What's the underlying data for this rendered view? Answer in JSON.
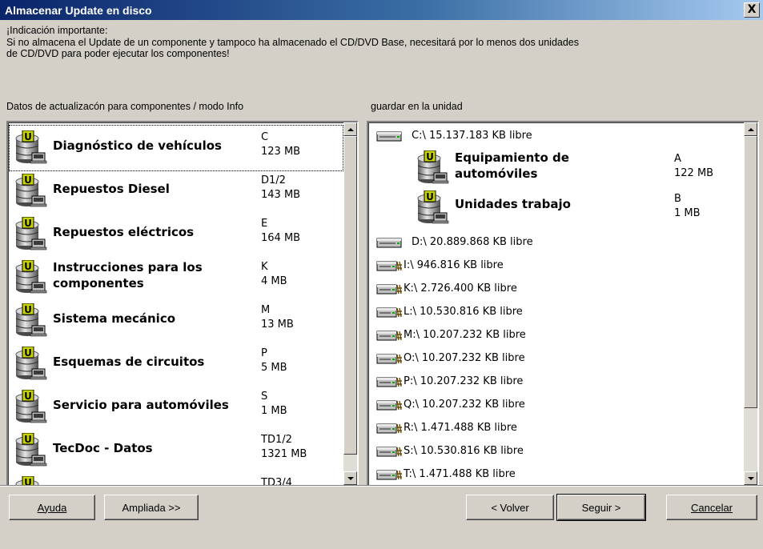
{
  "window": {
    "title": "Almacenar Update en disco",
    "close_glyph": "X"
  },
  "notice": {
    "line1": "¡Indicación importante:",
    "line2": "Si no almacena el Update de un componente y tampoco ha almacenado el CD/DVD Base, necesitará por lo menos dos unidades",
    "line3": "de CD/DVD para poder ejecutar los componentes!"
  },
  "left_label": "Datos de actualizacón para componentes / modo Info",
  "right_label": "guardar en la unidad",
  "components": [
    {
      "name1": "Diagnóstico de vehículos",
      "name2": "",
      "drive": "C",
      "size": "123 MB"
    },
    {
      "name1": "Repuestos Diesel",
      "name2": "",
      "drive": "D1/2",
      "size": "143 MB"
    },
    {
      "name1": "Repuestos eléctricos",
      "name2": "",
      "drive": "E",
      "size": "164 MB"
    },
    {
      "name1": "Instrucciones para los",
      "name2": "componentes",
      "drive": "K",
      "size": "4 MB"
    },
    {
      "name1": "Sistema mecánico",
      "name2": "",
      "drive": "M",
      "size": "13 MB"
    },
    {
      "name1": "Esquemas de circuitos",
      "name2": "",
      "drive": "P",
      "size": "5 MB"
    },
    {
      "name1": "Servicio para automóviles",
      "name2": "",
      "drive": "S",
      "size": "1 MB"
    },
    {
      "name1": "TecDoc - Datos",
      "name2": "",
      "drive": "TD1/2",
      "size": "1321 MB"
    },
    {
      "name1": "",
      "name2": "",
      "drive": "TD3/4",
      "size": ""
    }
  ],
  "drives": [
    {
      "text": "C:\\ 15.137.183 KB libre",
      "network": false
    },
    {
      "text": "D:\\ 20.889.868 KB libre",
      "network": false
    },
    {
      "text": "I:\\ 946.816 KB libre",
      "network": true
    },
    {
      "text": "K:\\ 2.726.400 KB libre",
      "network": true
    },
    {
      "text": "L:\\ 10.530.816 KB libre",
      "network": true
    },
    {
      "text": "M:\\ 10.207.232 KB libre",
      "network": true
    },
    {
      "text": "O:\\ 10.207.232 KB libre",
      "network": true
    },
    {
      "text": "P:\\ 10.207.232 KB libre",
      "network": true
    },
    {
      "text": "Q:\\ 10.207.232 KB libre",
      "network": true
    },
    {
      "text": "R:\\ 1.471.488 KB libre",
      "network": true
    },
    {
      "text": "S:\\ 10.530.816 KB libre",
      "network": true
    },
    {
      "text": "T:\\ 1.471.488 KB libre",
      "network": true
    }
  ],
  "assigned": [
    {
      "name1": "Equipamiento de",
      "name2": "automóviles",
      "drive": "A",
      "size": "122 MB"
    },
    {
      "name1": "Unidades trabajo",
      "name2": "",
      "drive": "B",
      "size": "1 MB"
    }
  ],
  "buttons": {
    "help": "Ayuda",
    "extended": "Ampliada >>",
    "back": "< Volver",
    "next": "Seguir >",
    "cancel": "Cancelar"
  },
  "icons": {
    "database": "database-update-icon",
    "drive": "hard-drive-icon",
    "network_drive": "network-drive-icon"
  },
  "colors": {
    "title_start": "#0a246a",
    "title_end": "#a6caf0",
    "badge": "#c8d400",
    "face": "#d4d0c8"
  }
}
